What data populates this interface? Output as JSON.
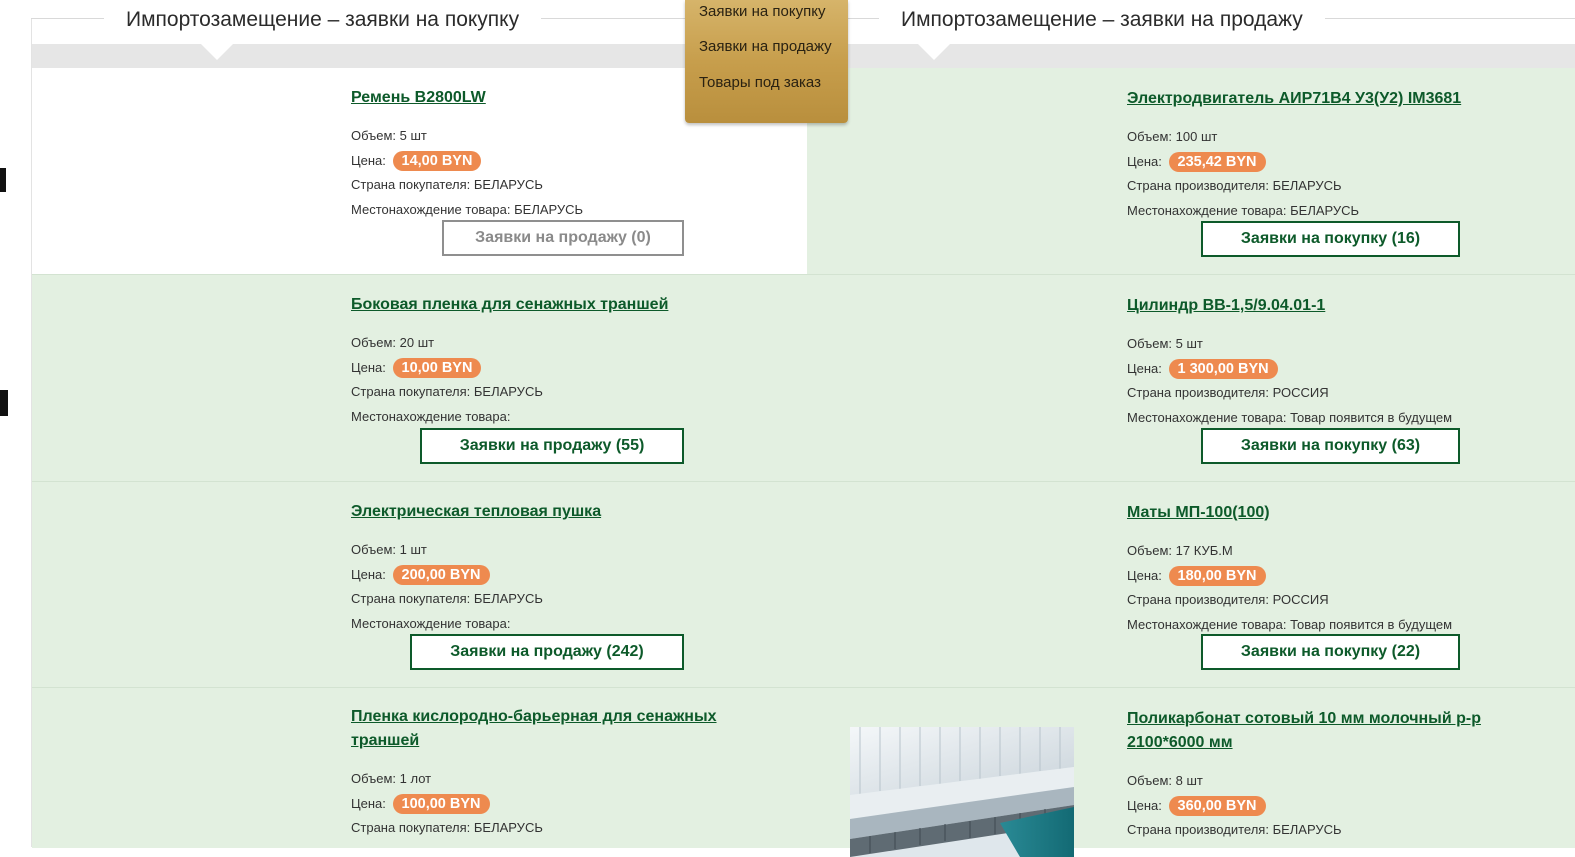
{
  "sections": {
    "purchase_title": "Импортозамещение – заявки на покупку",
    "sale_title": "Импортозамещение – заявки на продажу"
  },
  "dropdown": {
    "items": [
      "Заявки на покупку",
      "Заявки на продажу",
      "Товары под заказ"
    ]
  },
  "labels": {
    "volume": "Объем:",
    "price": "Цена:",
    "buyer_country": "Страна покупателя:",
    "producer_country": "Страна производителя:",
    "location": "Местонахождение товара:"
  },
  "purchase_items": [
    {
      "title": "Ремень B2800LW",
      "volume": "5 шт",
      "price": "14,00 BYN",
      "country": "БЕЛАРУСЬ",
      "location": "БЕЛАРУСЬ",
      "button": "Заявки на продажу (0)"
    },
    {
      "title": "Боковая пленка для сенажных траншей",
      "volume": "20 шт",
      "price": "10,00 BYN",
      "country": "БЕЛАРУСЬ",
      "location": "",
      "button": "Заявки на продажу (55)"
    },
    {
      "title": "Электрическая тепловая пушка",
      "volume": "1 шт",
      "price": "200,00 BYN",
      "country": "БЕЛАРУСЬ",
      "location": "",
      "button": "Заявки на продажу (242)"
    },
    {
      "title": "Пленка кислородно-барьерная для сенажных траншей",
      "volume": "1 лот",
      "price": "100,00 BYN",
      "country": "БЕЛАРУСЬ"
    }
  ],
  "sale_items": [
    {
      "title": "Электродвигатель АИР71В4 У3(У2) IM3681",
      "volume": "100 шт",
      "price": "235,42 BYN",
      "country": "БЕЛАРУСЬ",
      "location": "БЕЛАРУСЬ",
      "button": "Заявки на покупку (16)"
    },
    {
      "title": "Цилиндр ВВ-1,5/9.04.01-1",
      "volume": "5 шт",
      "price": "1 300,00 BYN",
      "country": "РОССИЯ",
      "location": "Товар появится в будущем",
      "button": "Заявки на покупку (63)"
    },
    {
      "title": "Маты МП-100(100)",
      "volume": "17 КУБ.М",
      "price": "180,00 BYN",
      "country": "РОССИЯ",
      "location": "Товар появится в будущем",
      "button": "Заявки на покупку (22)"
    },
    {
      "title": "Поликарбонат сотовый 10 мм молочный р-р 2100*6000 мм",
      "volume": "8 шт",
      "price": "360,00 BYN",
      "country": "БЕЛАРУСЬ"
    }
  ],
  "colors": {
    "accent_green": "#0d5a2a",
    "price_badge": "#ee8a4f",
    "row_green": "#e3f0e1",
    "dropdown_gold": "#c79e4c"
  },
  "icons": {
    "product_thumbnail": "polycarbonate-sheets-image"
  }
}
